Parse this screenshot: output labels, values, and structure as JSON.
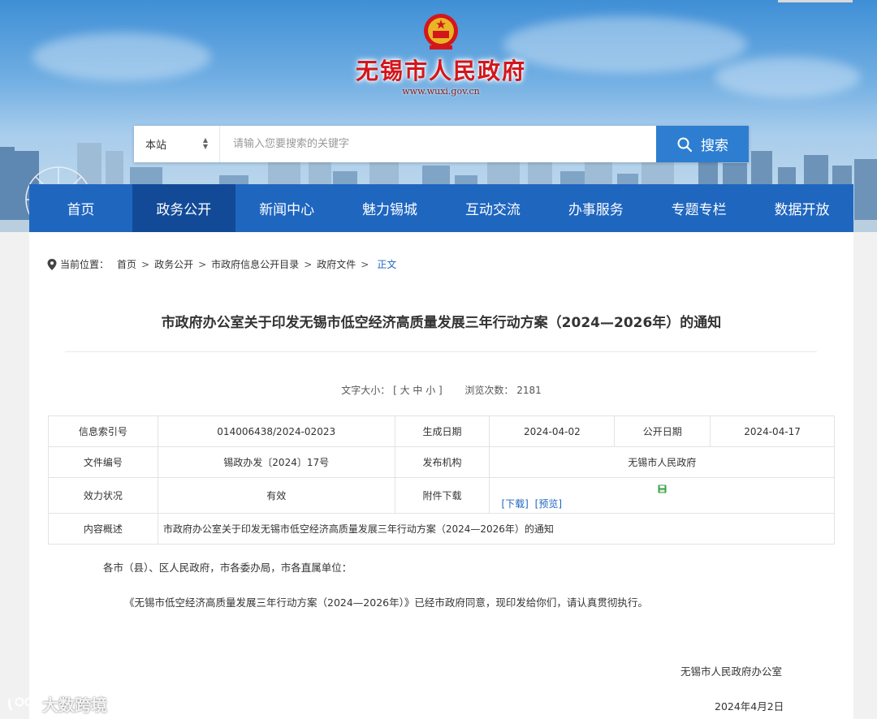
{
  "header": {
    "site_title": "无锡市人民政府",
    "site_url": "www.wuxi.gov.cn"
  },
  "search": {
    "scope_value": "本站",
    "placeholder": "请输入您要搜索的关键字",
    "button_label": "搜索"
  },
  "nav": {
    "items": [
      {
        "label": "首页"
      },
      {
        "label": "政务公开"
      },
      {
        "label": "新闻中心"
      },
      {
        "label": "魅力锡城"
      },
      {
        "label": "互动交流"
      },
      {
        "label": "办事服务"
      },
      {
        "label": "专题专栏"
      },
      {
        "label": "数据开放"
      }
    ],
    "active_index": 1
  },
  "breadcrumb": {
    "prefix": "当前位置：",
    "items": [
      "首页",
      "政务公开",
      "市政府信息公开目录",
      "政府文件"
    ],
    "current": "正文"
  },
  "article": {
    "title": "市政府办公室关于印发无锡市低空经济高质量发展三年行动方案（2024—2026年）的通知",
    "font_size_label": "文字大小：",
    "font_size_options": "[ 大 中 小 ]",
    "views_label": "浏览次数：",
    "views_count": "2181"
  },
  "info_table": {
    "index_label": "信息索引号",
    "index_value": "014006438/2024-02023",
    "created_label": "生成日期",
    "created_value": "2024-04-02",
    "published_label": "公开日期",
    "published_value": "2024-04-17",
    "doc_no_label": "文件编号",
    "doc_no_value": "锡政办发〔2024〕17号",
    "issuer_label": "发布机构",
    "issuer_value": "无锡市人民政府",
    "status_label": "效力状况",
    "status_value": "有效",
    "attachment_label": "附件下载",
    "download_link": "[下载]",
    "preview_link": "[预览]",
    "summary_label": "内容概述",
    "summary_value": "市政府办公室关于印发无锡市低空经济高质量发展三年行动方案（2024—2026年）的通知"
  },
  "body": {
    "salutation": "各市（县）、区人民政府，市各委办局，市各直属单位：",
    "paragraph": "《无锡市低空经济高质量发展三年行动方案（2024—2026年）》已经市政府同意，现印发给你们，请认真贯彻执行。",
    "signature": "无锡市人民政府办公室",
    "date": "2024年4月2日"
  },
  "watermark": {
    "text": "大数跨境"
  },
  "colors": {
    "nav_bg": "#1f66bf",
    "nav_active": "#124a98",
    "title_red": "#d4161b",
    "link_blue": "#1f66bf"
  }
}
